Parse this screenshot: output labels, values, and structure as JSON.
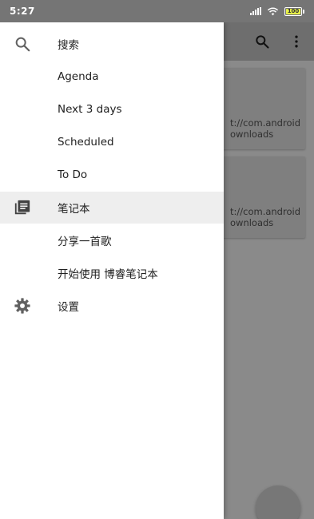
{
  "status_bar": {
    "time": "5:27",
    "battery": "100",
    "icons": [
      "signal-icon",
      "wifi-icon",
      "battery-icon"
    ]
  },
  "background_app": {
    "toolbar_icons": [
      "search-icon",
      "more-vert-icon"
    ],
    "cards": [
      {
        "line1": "t://com.android",
        "line2": "ownloads"
      },
      {
        "line1": "t://com.android",
        "line2": "ownloads"
      }
    ]
  },
  "drawer": {
    "items": [
      {
        "label": "搜索",
        "icon": "search-icon",
        "active": false
      },
      {
        "label": "Agenda",
        "icon": "",
        "active": false
      },
      {
        "label": "Next 3 days",
        "icon": "",
        "active": false
      },
      {
        "label": "Scheduled",
        "icon": "",
        "active": false
      },
      {
        "label": "To Do",
        "icon": "",
        "active": false
      },
      {
        "label": "笔记本",
        "icon": "notebook-icon",
        "active": true
      },
      {
        "label": "分享一首歌",
        "icon": "",
        "active": false
      },
      {
        "label": "开始使用 博睿笔记本",
        "icon": "",
        "active": false
      },
      {
        "label": "设置",
        "icon": "settings-icon",
        "active": false
      }
    ]
  },
  "colors": {
    "drawer_bg": "#ffffff",
    "active_item_bg": "#eeeeee",
    "scrim": "#8a8a8a",
    "statusbar": "#757575",
    "text": "#212121",
    "icon": "#616161"
  }
}
